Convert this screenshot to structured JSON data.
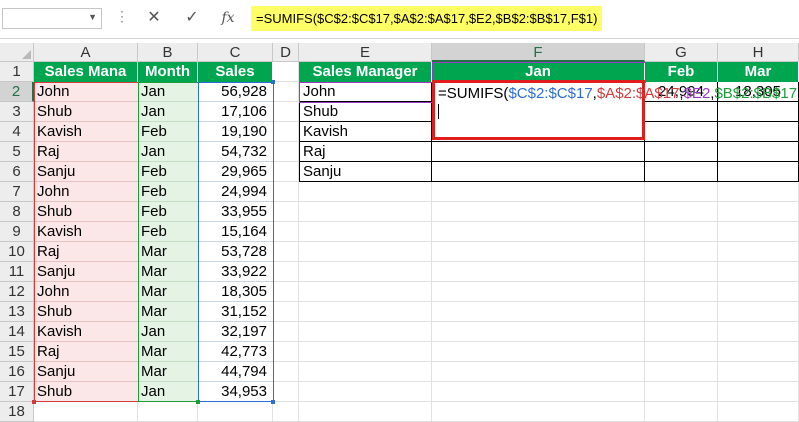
{
  "formula_bar": {
    "namebox": "",
    "cancel_icon": "✕",
    "enter_icon": "✓",
    "fx_label": "fx",
    "formula": "=SUMIFS($C$2:$C$17,$A$2:$A$17,$E2,$B$2:$B$17,F$1)"
  },
  "columns": [
    "A",
    "B",
    "C",
    "D",
    "E",
    "F",
    "G",
    "H"
  ],
  "rows": [
    "1",
    "2",
    "3",
    "4",
    "5",
    "6",
    "7",
    "8",
    "9",
    "10",
    "11",
    "12",
    "13",
    "14",
    "15",
    "16",
    "17",
    "18"
  ],
  "left_table": {
    "headers": [
      "Sales Mana",
      "Month",
      "Sales"
    ],
    "rows": [
      [
        "John",
        "Jan",
        "56,928"
      ],
      [
        "Shub",
        "Jan",
        "17,106"
      ],
      [
        "Kavish",
        "Feb",
        "19,190"
      ],
      [
        "Raj",
        "Jan",
        "54,732"
      ],
      [
        "Sanju",
        "Feb",
        "29,965"
      ],
      [
        "John",
        "Feb",
        "24,994"
      ],
      [
        "Shub",
        "Feb",
        "33,955"
      ],
      [
        "Kavish",
        "Feb",
        "15,164"
      ],
      [
        "Raj",
        "Mar",
        "53,728"
      ],
      [
        "Sanju",
        "Mar",
        "33,922"
      ],
      [
        "John",
        "Mar",
        "18,305"
      ],
      [
        "Shub",
        "Mar",
        "31,152"
      ],
      [
        "Kavish",
        "Jan",
        "32,197"
      ],
      [
        "Raj",
        "Mar",
        "42,773"
      ],
      [
        "Sanju",
        "Mar",
        "44,794"
      ],
      [
        "Shub",
        "Jan",
        "34,953"
      ]
    ]
  },
  "right_table": {
    "headers": [
      "Sales Manager",
      "Jan",
      "Feb",
      "Mar"
    ],
    "managers": [
      "John",
      "Shub",
      "Kavish",
      "Raj",
      "Sanju"
    ],
    "john_feb": "24,994",
    "john_mar": "18,305"
  },
  "edit_formula_parts": [
    {
      "text": "=SUMIFS(",
      "color": "black"
    },
    {
      "text": "$C$2:$C$17",
      "color": "blue"
    },
    {
      "text": ",",
      "color": "black"
    },
    {
      "text": "$A$2:$A$17",
      "color": "red"
    },
    {
      "text": ",",
      "color": "black"
    },
    {
      "text": "$E2",
      "color": "purple"
    },
    {
      "text": ",",
      "color": "black"
    },
    {
      "text": "$B$2:$B$17",
      "color": "green"
    },
    {
      "text": ",",
      "color": "black"
    },
    {
      "text": "F$1",
      "color": "purple"
    },
    {
      "text": ")",
      "color": "black"
    }
  ],
  "colors": {
    "header_green": "#00a550",
    "edit_border": "#e01e1e",
    "formula_highlight": "#ffff66"
  }
}
